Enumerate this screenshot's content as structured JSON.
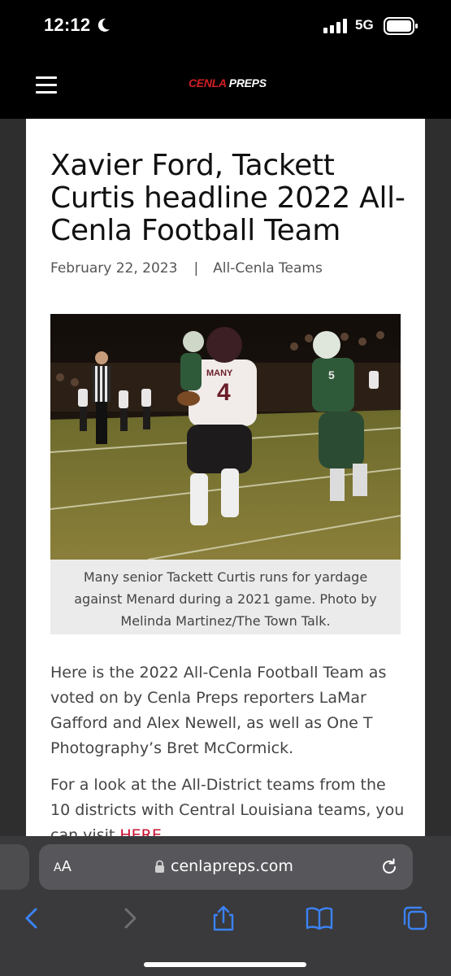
{
  "status_bar": {
    "time": "12:12",
    "network": "5G",
    "icons": [
      "moon-icon",
      "signal-icon",
      "battery-icon"
    ]
  },
  "site": {
    "logo_part1": "CENLA",
    "logo_part2": "PREPS",
    "menu_icon": "hamburger-menu-icon",
    "brand_color": "#d31e25"
  },
  "article": {
    "title": "Xavier Ford, Tackett Curtis headline 2022 All-Cenla Football Team",
    "date": "February 22, 2023",
    "separator": "|",
    "category": "All-Cenla Teams",
    "photo_caption": "Many senior Tackett Curtis runs for yardage against Menard during a 2021 game. Photo by Melinda Martinez/The Town Talk.",
    "paragraph1": "Here is the 2022 All-Cenla Football Team as voted on by Cenla Preps reporters LaMar Gafford and Alex Newell, as well as One T Photography’s Bret McCormick.",
    "paragraph2_text": "For a look at the All-District teams from the 10 districts with Central Louisiana teams, you can visit ",
    "paragraph2_link": "HERE",
    "paragraph2_end": "."
  },
  "browser": {
    "text_size_label_small": "A",
    "text_size_label_large": "A",
    "url": "cenlapreps.com",
    "toolbar": [
      "back-icon",
      "forward-icon",
      "share-icon",
      "bookmarks-icon",
      "tabs-icon"
    ]
  }
}
